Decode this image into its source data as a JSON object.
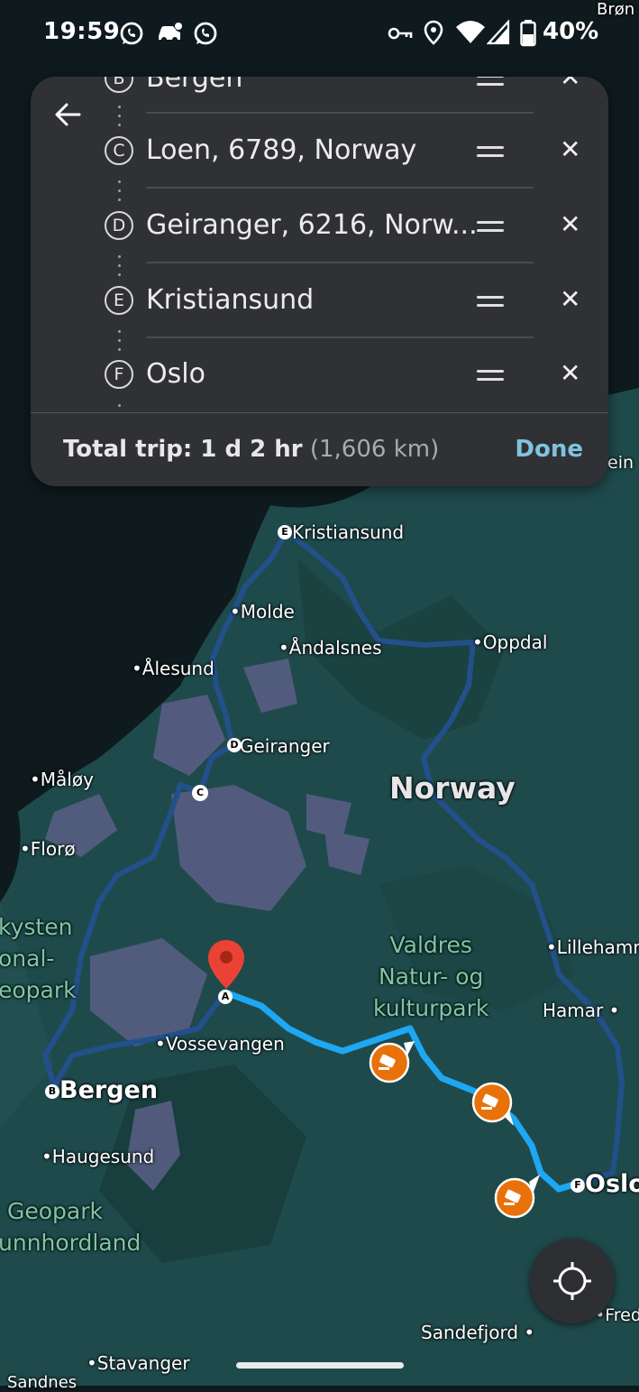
{
  "status_bar": {
    "time": "19:59",
    "battery": "40%",
    "notification_icons": [
      "whatsapp-icon",
      "car-icon",
      "whatsapp-icon"
    ],
    "system_icons": [
      "key-icon",
      "location-icon",
      "wifi-icon",
      "signal-icon",
      "battery-icon"
    ]
  },
  "route_panel": {
    "stops": [
      {
        "letter": "B",
        "label": "Bergen"
      },
      {
        "letter": "C",
        "label": "Loen, 6789, Norway"
      },
      {
        "letter": "D",
        "label": "Geiranger, 6216, Norw..."
      },
      {
        "letter": "E",
        "label": "Kristiansund"
      },
      {
        "letter": "F",
        "label": "Oslo"
      }
    ],
    "remove_glyph": "✕",
    "total_label": "Total trip: 1 d 2 hr",
    "total_distance": "(1,606 km)",
    "done_label": "Done"
  },
  "map": {
    "country_label": "Norway",
    "place_labels": {
      "kristiansund": "Kristiansund",
      "molde": "Molde",
      "andalsnes": "Åndalsnes",
      "oppdal": "Oppdal",
      "alesund": "Ålesund",
      "geiranger": "Geiranger",
      "maloy": "Måløy",
      "floro": "Florø",
      "lillehammer": "Lillehamm",
      "hamar": "Hamar",
      "vossevangen": "Vossevangen",
      "bergen": "Bergen",
      "oslo": "Oslo",
      "haugesund": "Haugesund",
      "sandefjord": "Sandefjord",
      "stavanger": "Stavanger",
      "sandnes": "Sandnes",
      "edge_top_right": "Brøn",
      "edge_right_1": "ein",
      "edge_right_2": "Fred"
    },
    "parks": {
      "valdres": [
        "Valdres",
        "Natur- og",
        "kulturpark"
      ],
      "kysten": [
        "kysten",
        "onal-",
        "eopark"
      ],
      "sunnhordland": [
        "Geopark",
        "unnhordland"
      ]
    },
    "marker_letters": {
      "a": "A",
      "b": "B",
      "c": "C",
      "d": "D",
      "e": "E",
      "f": "F"
    },
    "colors": {
      "land": "#1f4a4c",
      "water": "#0e1a1d",
      "mountain": "#5b5f86",
      "route_active": "#1ea7f2",
      "route_inactive": "#23508a",
      "camera_badge": "#e8710a",
      "pin": "#ea4335"
    }
  }
}
